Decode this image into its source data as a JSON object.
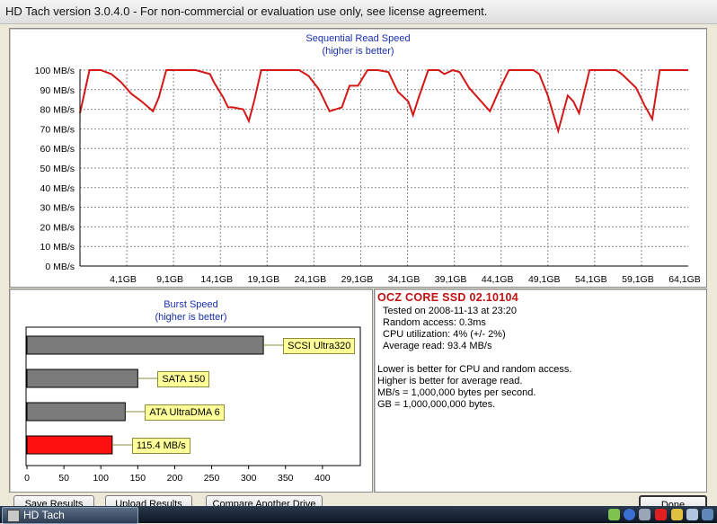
{
  "window": {
    "title": "HD Tach version 3.0.4.0  - For non-commercial or evaluation use only, see license agreement."
  },
  "colors": {
    "read_line": "#d41717",
    "burst_gray": "#7b7b7b",
    "burst_current": "#ff1010",
    "title_blue": "#1a2fae"
  },
  "chart_data": [
    {
      "type": "line",
      "title": "Sequential Read Speed",
      "subtitle": "(higher is better)",
      "y_ticks": [
        "0 MB/s",
        "10 MB/s",
        "20 MB/s",
        "30 MB/s",
        "40 MB/s",
        "50 MB/s",
        "60 MB/s",
        "70 MB/s",
        "80 MB/s",
        "90 MB/s",
        "100 MB/s"
      ],
      "x_ticks": [
        "4,1GB",
        "9,1GB",
        "14,1GB",
        "19,1GB",
        "24,1GB",
        "29,1GB",
        "34,1GB",
        "39,1GB",
        "44,1GB",
        "49,1GB",
        "54,1GB",
        "59,1GB",
        "64,1GB"
      ],
      "xlim": [
        0,
        64.1
      ],
      "ylim": [
        0,
        100
      ],
      "grid": true,
      "series": [
        {
          "x": [
            0,
            1.0,
            2.2,
            3.3,
            4.3,
            5.4,
            6.5,
            7.7,
            8.3,
            9.1,
            10.0,
            11.1,
            12.2,
            13.7,
            14.1,
            15.1,
            15.6,
            16.1,
            17.2,
            17.8,
            18.4,
            19.1,
            20.2,
            21.2,
            22.3,
            23.1,
            24.1,
            25.2,
            25.6,
            26.3,
            27.6,
            28.4,
            29.3,
            30.3,
            30.9,
            31.4,
            32.5,
            33.5,
            34.6,
            35.1,
            35.7,
            36.7,
            37.8,
            38.4,
            39.3,
            40.0,
            41.0,
            42.1,
            43.2,
            44.2,
            45.2,
            46.3,
            46.9,
            47.8,
            48.4,
            49.3,
            50.4,
            51.4,
            52.0,
            52.6,
            53.7,
            54.8,
            55.9,
            56.5,
            57.1,
            58.6,
            59.5,
            60.3,
            61.1,
            61.9,
            63.0,
            64.1
          ],
          "y": [
            78,
            100,
            100,
            98,
            94,
            88,
            84,
            79,
            86,
            100,
            100,
            100,
            100,
            98,
            94,
            86,
            81,
            81,
            80,
            74,
            85,
            100,
            100,
            100,
            100,
            100,
            97,
            90,
            86,
            79,
            81,
            92,
            92,
            100,
            100,
            100,
            99,
            89,
            84,
            77,
            86,
            100,
            100,
            98,
            100,
            99,
            91,
            85,
            79,
            90,
            100,
            100,
            100,
            100,
            98,
            87,
            69,
            87,
            84,
            78,
            100,
            100,
            100,
            100,
            98,
            91,
            82,
            75,
            100,
            100,
            100,
            100
          ]
        }
      ]
    },
    {
      "type": "bar",
      "orientation": "horizontal",
      "title": "Burst Speed",
      "subtitle": "(higher is better)",
      "categories": [
        "SCSI Ultra320",
        "SATA 150",
        "ATA UltraDMA 6",
        "115.4 MB/s"
      ],
      "values": [
        320,
        150,
        133,
        115.4
      ],
      "xlim": [
        0,
        450
      ],
      "x_ticks": [
        "0",
        "50",
        "100",
        "150",
        "200",
        "250",
        "300",
        "350",
        "400"
      ],
      "grid": false
    }
  ],
  "info": {
    "drive": "OCZ CORE SSD 02.10104",
    "tested": "Tested on 2008-11-13 at 23:20",
    "random_access": "Random access: 0.3ms",
    "cpu": "CPU utilization: 4% (+/- 2%)",
    "average": "Average read: 93.4 MB/s",
    "note1": "Lower is better for CPU and random access.",
    "note2": "Higher is better for average read.",
    "note3": "MB/s = 1,000,000 bytes per second.",
    "note4": "GB = 1,000,000,000 bytes."
  },
  "buttons": {
    "save": "Save Results",
    "upload": "Upload Results",
    "compare": "Compare Another Drive",
    "done": "Done"
  },
  "taskbar": {
    "item": "HD Tach",
    "tray_icons": [
      "network-icon",
      "info-icon",
      "disk-icon",
      "antivirus-icon",
      "power-icon",
      "volume-icon",
      "monitor-icon"
    ]
  }
}
